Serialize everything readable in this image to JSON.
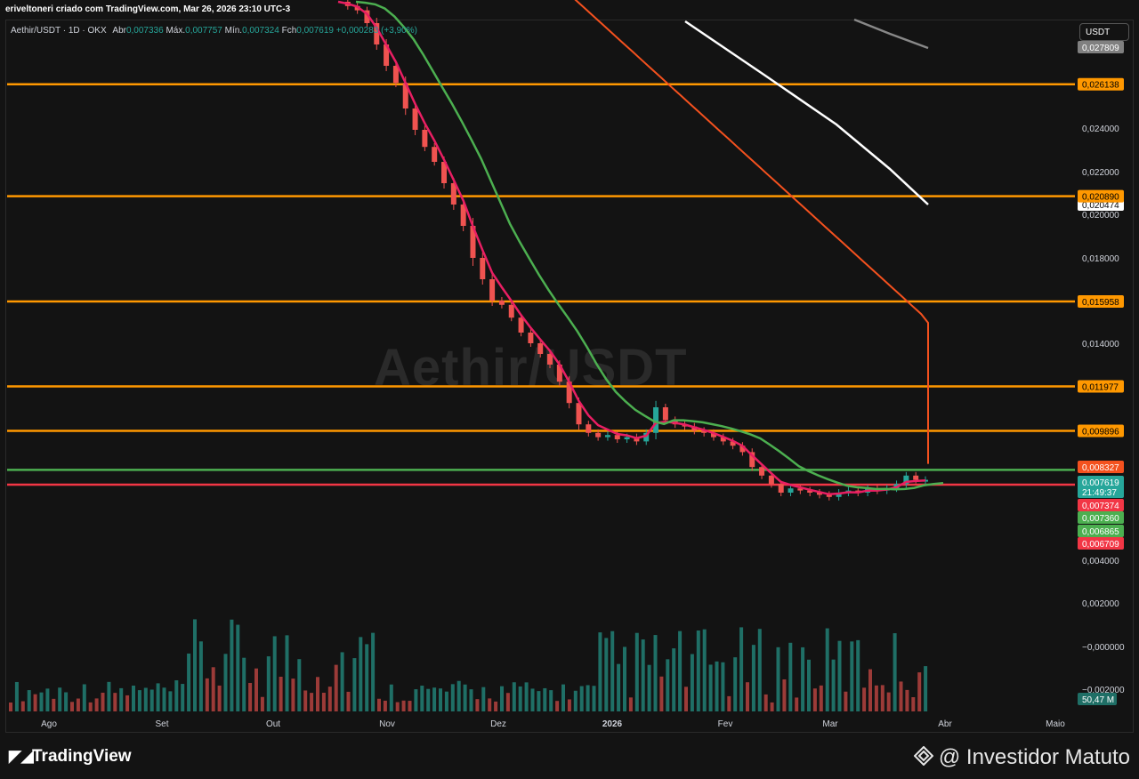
{
  "header": {
    "credit": "eriveltoneri criado com TradingView.com, Mar 26, 2026 23:10 UTC-3",
    "symbol": "Aethir/USDT · 1D · OKX",
    "o_label": "Abr",
    "o_val": "0,007336",
    "h_label": "Máx.",
    "h_val": "0,007757",
    "l_label": "Mín.",
    "l_val": "0,007324",
    "c_label": "Fch",
    "c_val": "0,007619",
    "chg_val": "+0,000283 (+3,90%)"
  },
  "watermark": "Aethir/USDT",
  "currency_badge": "USDT",
  "footer": {
    "brand": "TradingView",
    "author": "@ Investidor Matuto"
  },
  "colors": {
    "up": "#26a69a",
    "down": "#ef5350",
    "level": "#ff9800",
    "ema_fast": "#e91e63",
    "ema_mid": "#4caf50",
    "ema_slow": "#f4511e",
    "ema_200": "#ffffff",
    "ema_long": "#888888"
  },
  "chart_data": {
    "type": "candlestick",
    "y_axis_ticks": [
      "0,024000",
      "0,022000",
      "0,020000",
      "0,018000",
      "0,014000",
      "0,004000",
      "0,002000",
      "−0,000000",
      "−0,002000"
    ],
    "x_axis_ticks": [
      "Ago",
      "Set",
      "Out",
      "Nov",
      "Dez",
      "2026",
      "Fev",
      "Mar",
      "Abr",
      "Maio"
    ],
    "horizontal_levels": [
      {
        "value": "0,026138"
      },
      {
        "value": "0,020890"
      },
      {
        "value": "0,015958"
      },
      {
        "value": "0,011977"
      },
      {
        "value": "0,009896"
      }
    ],
    "support_lines": [
      {
        "value": "0,007360",
        "color": "#4caf50"
      },
      {
        "value": "0,007374",
        "color": "#f23645"
      }
    ],
    "price_labels": [
      {
        "text": "0,027809",
        "bg": "#808080",
        "fg": "#ffffff"
      },
      {
        "text": "0,020474",
        "bg": "#ffffff",
        "fg": "#000000"
      },
      {
        "text": "0,008327",
        "bg": "#f4511e",
        "fg": "#ffffff"
      },
      {
        "text": "0,007619",
        "bg": "#26a69a",
        "fg": "#ffffff"
      },
      {
        "text": "21:49:37",
        "bg": "#26a69a",
        "fg": "#ffffff"
      },
      {
        "text": "0,007374",
        "bg": "#f23645",
        "fg": "#ffffff"
      },
      {
        "text": "0,007360",
        "bg": "#4caf50",
        "fg": "#ffffff"
      },
      {
        "text": "0,006865",
        "bg": "#4caf50",
        "fg": "#ffffff"
      },
      {
        "text": "0,006709",
        "bg": "#f23645",
        "fg": "#ffffff"
      }
    ],
    "volume_label": "50,47 M",
    "closes": [
      0.03,
      0.0298,
      0.0296,
      0.029,
      0.028,
      0.027,
      0.0262,
      0.025,
      0.024,
      0.0232,
      0.0225,
      0.0215,
      0.0205,
      0.0195,
      0.018,
      0.017,
      0.016,
      0.0158,
      0.0152,
      0.0145,
      0.014,
      0.0135,
      0.013,
      0.0122,
      0.0112,
      0.0102,
      0.0098,
      0.0096,
      0.0097,
      0.0095,
      0.0096,
      0.0094,
      0.0098,
      0.011,
      0.0104,
      0.0102,
      0.0101,
      0.0099,
      0.0098,
      0.0096,
      0.0094,
      0.0092,
      0.0089,
      0.0082,
      0.0078,
      0.0074,
      0.007,
      0.0072,
      0.0071,
      0.007,
      0.0069,
      0.0068,
      0.007,
      0.0071,
      0.007,
      0.0072,
      0.0071,
      0.0072,
      0.0074,
      0.0078,
      0.0076,
      0.0076
    ]
  }
}
